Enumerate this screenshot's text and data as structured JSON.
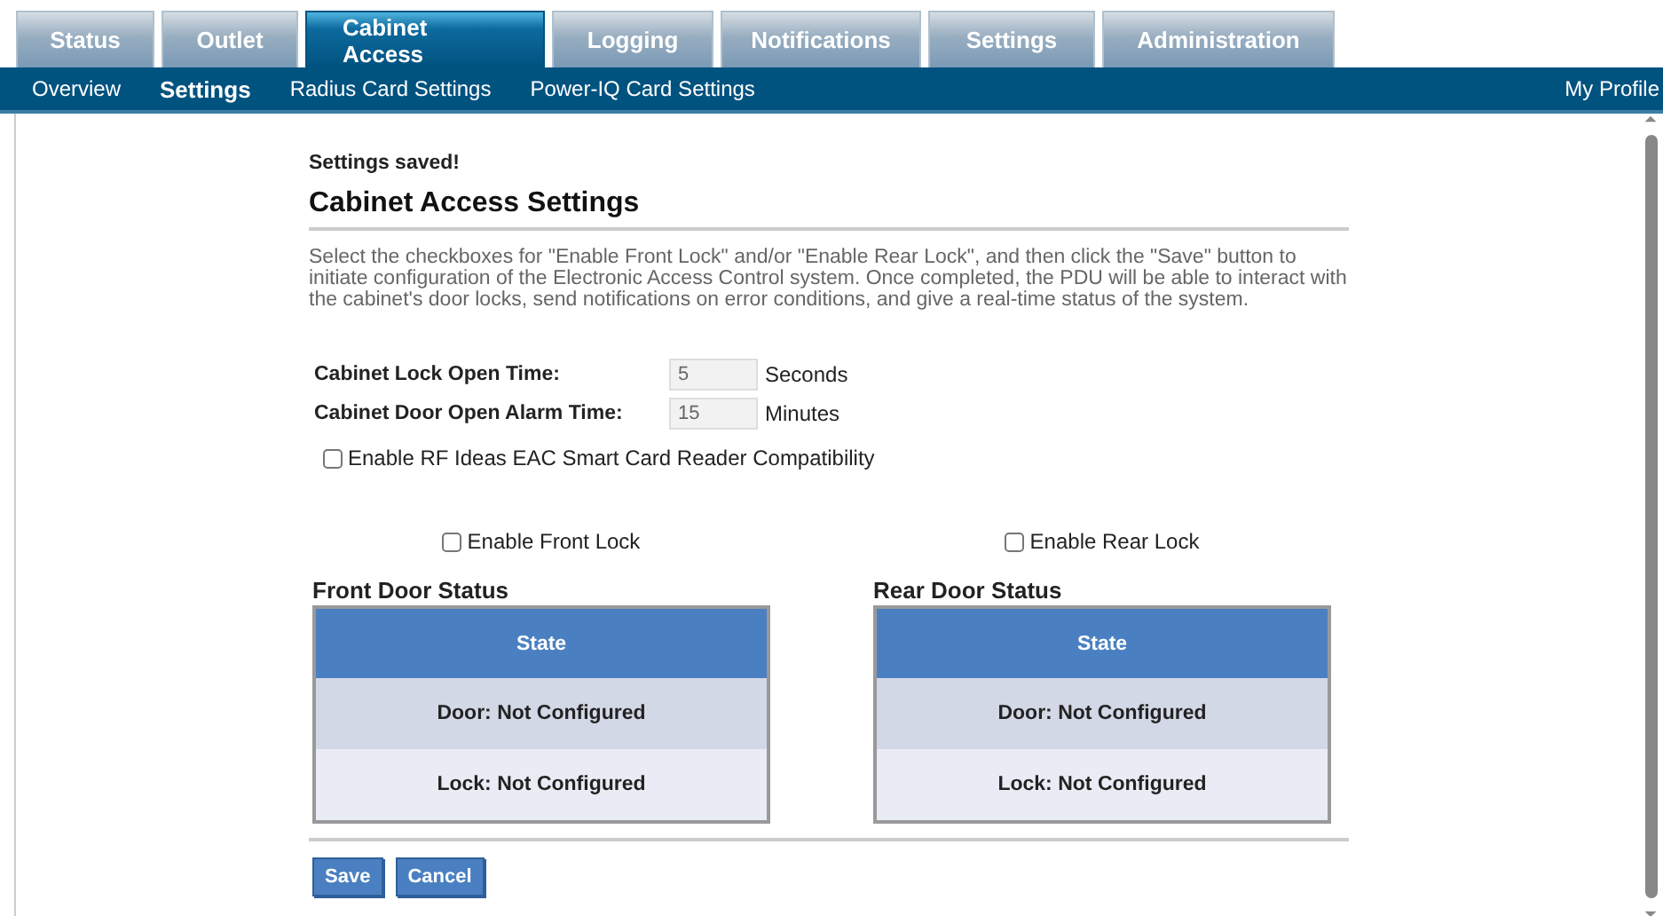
{
  "tabs": [
    {
      "label": "Status",
      "selected": false
    },
    {
      "label": "Outlet",
      "selected": false
    },
    {
      "label": "Cabinet Access",
      "selected": true
    },
    {
      "label": "Logging",
      "selected": false
    },
    {
      "label": "Notifications",
      "selected": false
    },
    {
      "label": "Settings",
      "selected": false
    },
    {
      "label": "Administration",
      "selected": false
    }
  ],
  "subnav": {
    "items": [
      {
        "label": "Overview",
        "selected": false
      },
      {
        "label": "Settings",
        "selected": true
      },
      {
        "label": "Radius Card Settings",
        "selected": false
      },
      {
        "label": "Power-IQ Card Settings",
        "selected": false
      }
    ],
    "profile": "My Profile"
  },
  "message": "Settings saved!",
  "heading": "Cabinet Access Settings",
  "description": "Select the checkboxes for \"Enable Front Lock\" and/or \"Enable Rear Lock\", and then click the \"Save\" button to initiate configuration of the Electronic Access Control system. Once completed, the PDU will be able to interact with the cabinet's door locks, send notifications on error conditions, and give a real-time status of the system.",
  "fields": [
    {
      "label": "Cabinet Lock Open Time:",
      "value": "5",
      "unit": "Seconds"
    },
    {
      "label": "Cabinet Door Open Alarm Time:",
      "value": "15",
      "unit": "Minutes"
    }
  ],
  "rf_ideas": {
    "label": "Enable RF Ideas EAC Smart Card Reader Compatibility",
    "checked": false
  },
  "doors": [
    {
      "enable_label": "Enable Front Lock",
      "checked": false,
      "title": "Front Door Status",
      "header": "State",
      "rows": [
        "Door: Not Configured",
        "Lock: Not Configured"
      ]
    },
    {
      "enable_label": "Enable Rear Lock",
      "checked": false,
      "title": "Rear Door Status",
      "header": "State",
      "rows": [
        "Door: Not Configured",
        "Lock: Not Configured"
      ]
    }
  ],
  "buttons": [
    "Save",
    "Cancel"
  ]
}
